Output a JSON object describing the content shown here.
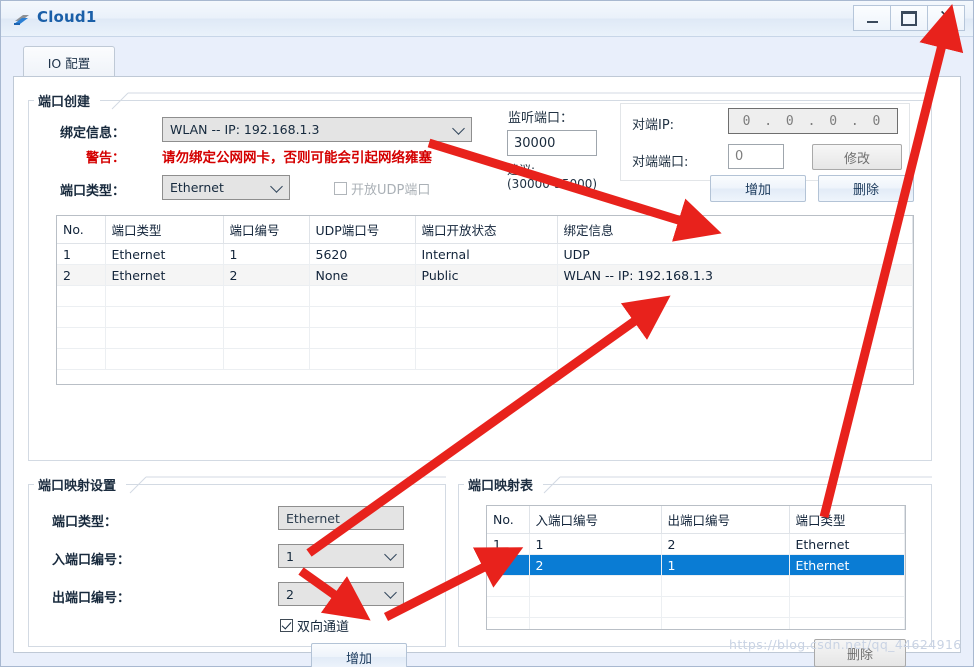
{
  "window": {
    "title": "Cloud1",
    "icon": "cloud-device-icon",
    "minimize_label": "—",
    "maximize_label": "□",
    "close_label": "✕"
  },
  "tabs": [
    {
      "label": "IO 配置",
      "selected": true
    }
  ],
  "port_create": {
    "group_title": "端口创建",
    "bind_info_label": "绑定信息：",
    "bind_info_value": "WLAN -- IP: 192.168.1.3",
    "warning_label": "警告：",
    "warning_text": "请勿绑定公网网卡，否则可能会引起网络雍塞",
    "port_type_label": "端口类型：",
    "port_type_value": "Ethernet",
    "udp_checkbox_label": "开放UDP端口",
    "udp_checkbox_checked": false,
    "listen_port_label": "监听端口：",
    "listen_port_value": "30000",
    "listen_port_hint_line1": "建议:",
    "listen_port_hint_line2": "(30000-35000)",
    "peer_ip_label": "对端IP:",
    "peer_ip_value": "0 . 0 . 0 . 0",
    "peer_port_label": "对端端口:",
    "peer_port_value": "0",
    "modify_button": "修改",
    "add_button": "增加",
    "delete_button": "删除"
  },
  "port_table": {
    "columns": [
      "No.",
      "端口类型",
      "端口编号",
      "UDP端口号",
      "端口开放状态",
      "绑定信息"
    ],
    "rows": [
      {
        "no": "1",
        "type": "Ethernet",
        "number": "1",
        "udp": "5620",
        "state": "Internal",
        "bind": "UDP",
        "selected": false
      },
      {
        "no": "2",
        "type": "Ethernet",
        "number": "2",
        "udp": "None",
        "state": "Public",
        "bind": "WLAN -- IP: 192.168.1.3",
        "selected": false
      }
    ],
    "empty_rows": 4
  },
  "mapping_settings": {
    "group_title": "端口映射设置",
    "port_type_label": "端口类型：",
    "port_type_value": "Ethernet",
    "in_port_label": "入端口编号：",
    "in_port_value": "1",
    "out_port_label": "出端口编号：",
    "out_port_value": "2",
    "bidirectional_label": "双向通道",
    "bidirectional_checked": true,
    "add_button": "增加"
  },
  "mapping_table": {
    "group_title": "端口映射表",
    "columns": [
      "No.",
      "入端口编号",
      "出端口编号",
      "端口类型"
    ],
    "rows": [
      {
        "no": "1",
        "in": "1",
        "out": "2",
        "type": "Ethernet",
        "selected": false
      },
      {
        "no": "2",
        "in": "2",
        "out": "1",
        "type": "Ethernet",
        "selected": true
      }
    ],
    "empty_rows": 3,
    "delete_button": "删除"
  },
  "watermark": "https://blog.csdn.net/qq_44624916",
  "colors": {
    "title_text": "#1a5fa8",
    "warning": "#d40000",
    "selection": "#0a7cd4",
    "annotation_arrow": "#e8221c",
    "window_bg": "#e9effb"
  }
}
